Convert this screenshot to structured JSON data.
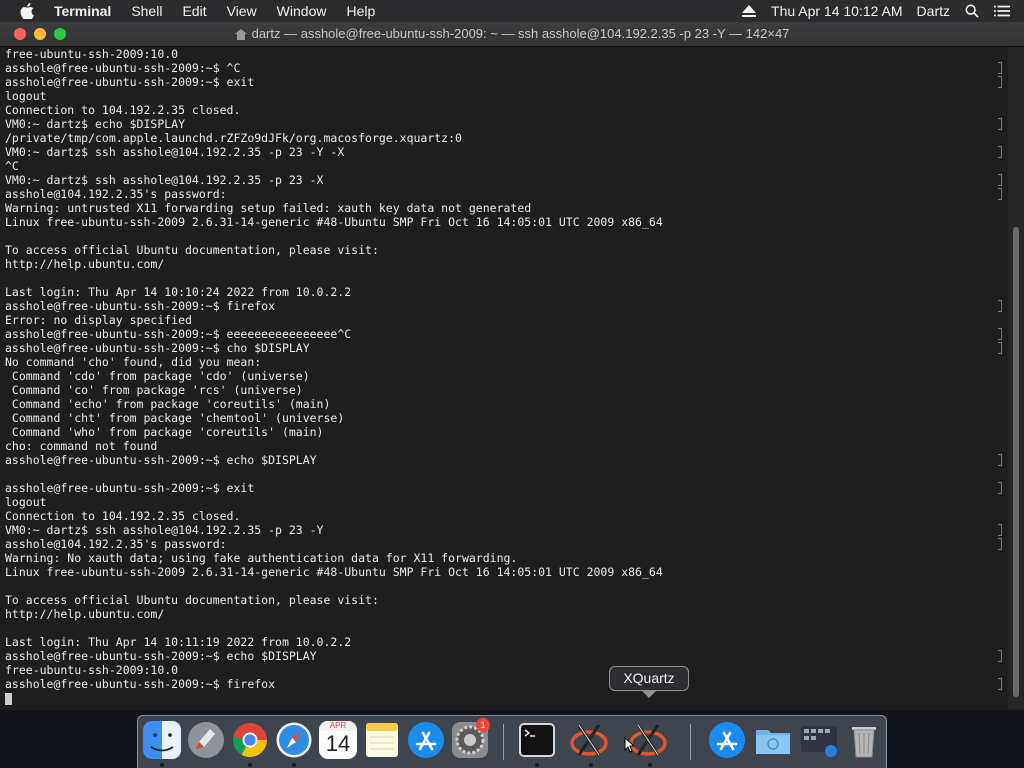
{
  "menubar": {
    "apple_icon": "apple-logo-icon",
    "app_name": "Terminal",
    "items": [
      "Shell",
      "Edit",
      "View",
      "Window",
      "Help"
    ],
    "clock": "Thu Apr 14  10:12 AM",
    "user": "Dartz",
    "status_icons": [
      "eject-icon",
      "search-icon",
      "list-icon"
    ]
  },
  "window": {
    "title": "dartz — asshole@free-ubuntu-ssh-2009: ~ — ssh asshole@104.192.2.35 -p 23 -Y — 142×47",
    "title_icon": "home-folder-icon"
  },
  "terminal": {
    "lines": [
      {
        "text": "free-ubuntu-ssh-2009:10.0",
        "mark": false
      },
      {
        "text": "asshole@free-ubuntu-ssh-2009:~$ ^C",
        "mark": true
      },
      {
        "text": "asshole@free-ubuntu-ssh-2009:~$ exit",
        "mark": true
      },
      {
        "text": "logout",
        "mark": false
      },
      {
        "text": "Connection to 104.192.2.35 closed.",
        "mark": false
      },
      {
        "text": "VM0:~ dartz$ echo $DISPLAY",
        "mark": true
      },
      {
        "text": "/private/tmp/com.apple.launchd.rZFZo9dJFk/org.macosforge.xquartz:0",
        "mark": false
      },
      {
        "text": "VM0:~ dartz$ ssh asshole@104.192.2.35 -p 23 -Y -X",
        "mark": true
      },
      {
        "text": "^C",
        "mark": false
      },
      {
        "text": "VM0:~ dartz$ ssh asshole@104.192.2.35 -p 23 -X",
        "mark": true
      },
      {
        "text": "asshole@104.192.2.35's password:",
        "mark": true
      },
      {
        "text": "Warning: untrusted X11 forwarding setup failed: xauth key data not generated",
        "mark": false
      },
      {
        "text": "Linux free-ubuntu-ssh-2009 2.6.31-14-generic #48-Ubuntu SMP Fri Oct 16 14:05:01 UTC 2009 x86_64",
        "mark": false
      },
      {
        "text": "",
        "mark": false
      },
      {
        "text": "To access official Ubuntu documentation, please visit:",
        "mark": false
      },
      {
        "text": "http://help.ubuntu.com/",
        "mark": false
      },
      {
        "text": "",
        "mark": false
      },
      {
        "text": "Last login: Thu Apr 14 10:10:24 2022 from 10.0.2.2",
        "mark": false
      },
      {
        "text": "asshole@free-ubuntu-ssh-2009:~$ firefox",
        "mark": true
      },
      {
        "text": "Error: no display specified",
        "mark": false
      },
      {
        "text": "asshole@free-ubuntu-ssh-2009:~$ eeeeeeeeeeeeeeee^C",
        "mark": true
      },
      {
        "text": "asshole@free-ubuntu-ssh-2009:~$ cho $DISPLAY",
        "mark": true
      },
      {
        "text": "No command 'cho' found, did you mean:",
        "mark": false
      },
      {
        "text": " Command 'cdo' from package 'cdo' (universe)",
        "mark": false
      },
      {
        "text": " Command 'co' from package 'rcs' (universe)",
        "mark": false
      },
      {
        "text": " Command 'echo' from package 'coreutils' (main)",
        "mark": false
      },
      {
        "text": " Command 'cht' from package 'chemtool' (universe)",
        "mark": false
      },
      {
        "text": " Command 'who' from package 'coreutils' (main)",
        "mark": false
      },
      {
        "text": "cho: command not found",
        "mark": false
      },
      {
        "text": "asshole@free-ubuntu-ssh-2009:~$ echo $DISPLAY",
        "mark": true
      },
      {
        "text": "",
        "mark": false
      },
      {
        "text": "asshole@free-ubuntu-ssh-2009:~$ exit",
        "mark": true
      },
      {
        "text": "logout",
        "mark": false
      },
      {
        "text": "Connection to 104.192.2.35 closed.",
        "mark": false
      },
      {
        "text": "VM0:~ dartz$ ssh asshole@104.192.2.35 -p 23 -Y",
        "mark": true
      },
      {
        "text": "asshole@104.192.2.35's password:",
        "mark": true
      },
      {
        "text": "Warning: No xauth data; using fake authentication data for X11 forwarding.",
        "mark": false
      },
      {
        "text": "Linux free-ubuntu-ssh-2009 2.6.31-14-generic #48-Ubuntu SMP Fri Oct 16 14:05:01 UTC 2009 x86_64",
        "mark": false
      },
      {
        "text": "",
        "mark": false
      },
      {
        "text": "To access official Ubuntu documentation, please visit:",
        "mark": false
      },
      {
        "text": "http://help.ubuntu.com/",
        "mark": false
      },
      {
        "text": "",
        "mark": false
      },
      {
        "text": "Last login: Thu Apr 14 10:11:19 2022 from 10.0.2.2",
        "mark": false
      },
      {
        "text": "asshole@free-ubuntu-ssh-2009:~$ echo $DISPLAY",
        "mark": true
      },
      {
        "text": "free-ubuntu-ssh-2009:10.0",
        "mark": false
      },
      {
        "text": "asshole@free-ubuntu-ssh-2009:~$ firefox",
        "mark": true
      }
    ]
  },
  "dock": {
    "tooltip": "XQuartz",
    "calendar_month": "APR",
    "calendar_day": "14",
    "settings_badge": "1",
    "apps": [
      "finder-icon",
      "launchpad-icon",
      "chrome-icon",
      "safari-icon",
      "calendar-icon",
      "notes-icon",
      "app-store-icon",
      "system-preferences-icon",
      "terminal-icon",
      "xquartz-icon",
      "xquartz-icon",
      "app-store-icon",
      "downloads-folder-icon",
      "screenshot-app-icon",
      "trash-icon"
    ]
  }
}
